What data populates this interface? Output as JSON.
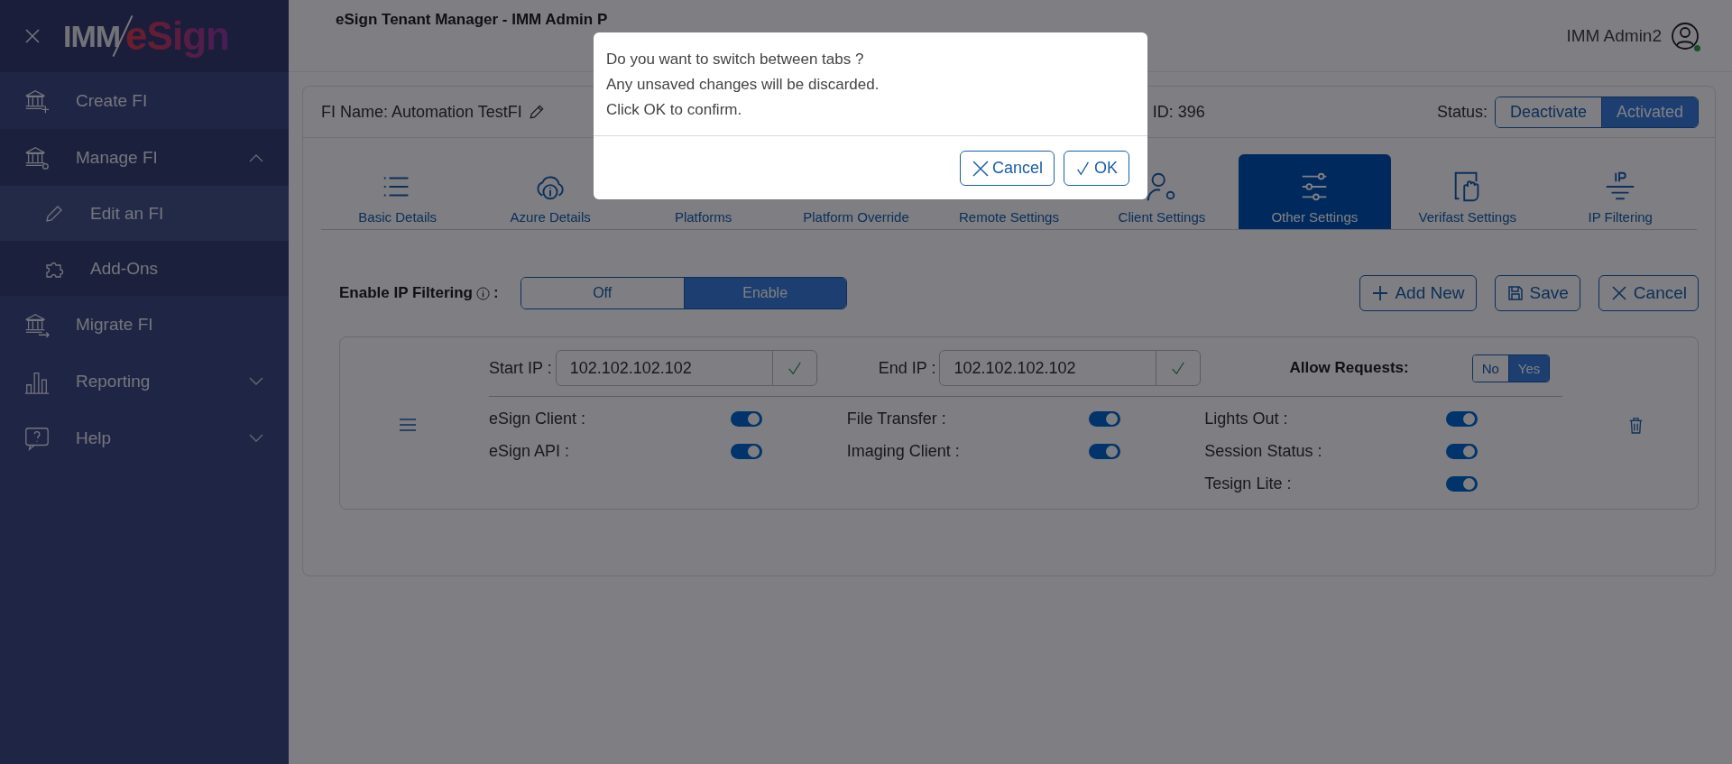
{
  "sidebar": {
    "logo": {
      "left": "IMM",
      "right": "eSign"
    },
    "items": [
      {
        "label": "Create FI"
      },
      {
        "label": "Manage FI",
        "expanded": true,
        "children": [
          {
            "label": "Edit an FI",
            "selected": true
          },
          {
            "label": "Add-Ons",
            "selected": false
          }
        ]
      },
      {
        "label": "Migrate FI"
      },
      {
        "label": "Reporting",
        "expanded": false
      },
      {
        "label": "Help",
        "expanded": false
      }
    ]
  },
  "header": {
    "title": "eSign Tenant Manager - IMM Admin P",
    "user": "IMM Admin2",
    "online": true
  },
  "fi": {
    "name_label": "FI Name: Automation TestFI",
    "id_label": "ID: 396",
    "status_label": "Status:",
    "status_options": [
      {
        "label": "Deactivate",
        "selected": false
      },
      {
        "label": "Activated",
        "selected": true
      }
    ]
  },
  "tabs": [
    {
      "label": "Basic Details",
      "selected": false
    },
    {
      "label": "Azure Details",
      "selected": false
    },
    {
      "label": "Platforms",
      "selected": false
    },
    {
      "label": "Platform Override",
      "selected": false
    },
    {
      "label": "Remote Settings",
      "selected": false
    },
    {
      "label": "Client Settings",
      "selected": false
    },
    {
      "label": "Other Settings",
      "selected": true
    },
    {
      "label": "Verifast Settings",
      "selected": false
    },
    {
      "label": "IP Filtering",
      "selected": false
    }
  ],
  "ip_filtering": {
    "label": "Enable IP Filtering",
    "suffix": ":",
    "options": [
      {
        "label": "Off",
        "selected": false
      },
      {
        "label": "Enable",
        "selected": true
      }
    ],
    "buttons": [
      "Add New",
      "Save",
      "Cancel"
    ]
  },
  "rules": [
    {
      "start_label": "Start IP :",
      "start_value": "102.102.102.102",
      "end_label": "End IP :",
      "end_value": "102.102.102.102",
      "allow_label": "Allow Requests:",
      "allow_options": [
        {
          "label": "No",
          "selected": false
        },
        {
          "label": "Yes",
          "selected": true
        }
      ],
      "switches": [
        [
          {
            "label": "eSign Client :",
            "on": true
          },
          {
            "label": "eSign API :",
            "on": true
          }
        ],
        [
          {
            "label": "File Transfer :",
            "on": true
          },
          {
            "label": "Imaging Client :",
            "on": true
          }
        ],
        [
          {
            "label": "Lights Out :",
            "on": true
          },
          {
            "label": "Session Status :",
            "on": true
          },
          {
            "label": "Tesign Lite :",
            "on": true
          }
        ]
      ]
    }
  ],
  "dialog": {
    "lines": [
      "Do you want to switch between tabs ?",
      "Any unsaved changes will be discarded.",
      "Click OK to confirm."
    ],
    "buttons": [
      "Cancel",
      "OK"
    ]
  }
}
